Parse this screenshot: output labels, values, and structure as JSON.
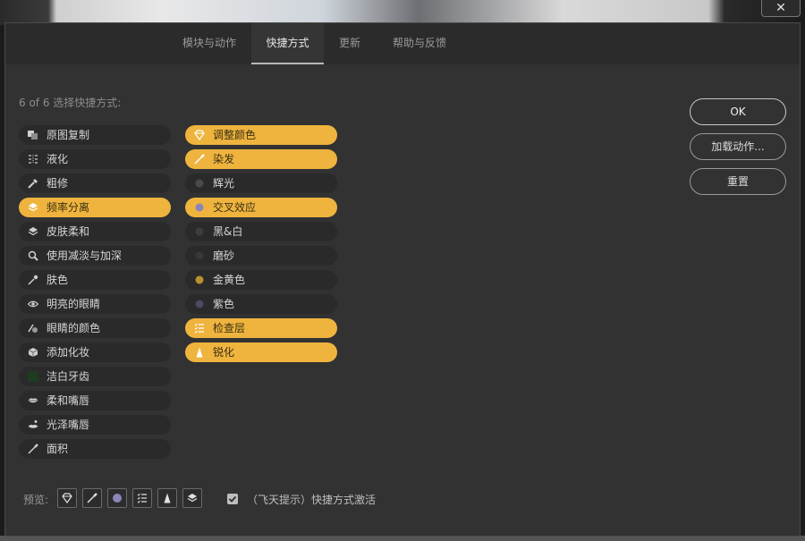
{
  "window": {
    "close_glyph": "✕"
  },
  "tabs": [
    {
      "label": "模块与动作",
      "active": false
    },
    {
      "label": "快捷方式",
      "active": true
    },
    {
      "label": "更新",
      "active": false
    },
    {
      "label": "帮助与反馈",
      "active": false
    }
  ],
  "selection_count": "6 of 6 选择快捷方式:",
  "left_list": [
    {
      "label": "原图复制",
      "icon": "copy-icon",
      "selected": false
    },
    {
      "label": "液化",
      "icon": "liquify-icon",
      "selected": false
    },
    {
      "label": "粗修",
      "icon": "healing-brush-icon",
      "selected": false
    },
    {
      "label": "频率分离",
      "icon": "layers-icon",
      "selected": true
    },
    {
      "label": "皮肤柔和",
      "icon": "layers-icon",
      "selected": false
    },
    {
      "label": "使用减淡与加深",
      "icon": "dodge-burn-icon",
      "selected": false
    },
    {
      "label": "肤色",
      "icon": "eyedropper-icon",
      "selected": false
    },
    {
      "label": "明亮的眼睛",
      "icon": "eye-icon",
      "selected": false
    },
    {
      "label": "眼睛的颜色",
      "icon": "eye-color-icon",
      "selected": false
    },
    {
      "label": "添加化妆",
      "icon": "cube-icon",
      "selected": false
    },
    {
      "label": "洁白牙齿",
      "icon": "tooth-icon",
      "selected": false
    },
    {
      "label": "柔和嘴唇",
      "icon": "lips-icon",
      "selected": false
    },
    {
      "label": "光泽嘴唇",
      "icon": "lips-gloss-icon",
      "selected": false
    },
    {
      "label": "面积",
      "icon": "brush-icon",
      "selected": false
    }
  ],
  "right_list": [
    {
      "label": "调整颜色",
      "icon": "diamond-icon",
      "selected": true
    },
    {
      "label": "染发",
      "icon": "brush-icon",
      "selected": true
    },
    {
      "label": "辉光",
      "icon": "dark-dot-icon",
      "selected": false
    },
    {
      "label": "交叉效应",
      "icon": "lavender-dot-icon",
      "selected": true
    },
    {
      "label": "黑&白",
      "icon": "dark-dot-icon",
      "selected": false
    },
    {
      "label": "磨砂",
      "icon": "dark-dot-icon",
      "selected": false
    },
    {
      "label": "金黄色",
      "icon": "gold-dot-icon",
      "selected": false
    },
    {
      "label": "紫色",
      "icon": "purple-dot-icon",
      "selected": false
    },
    {
      "label": "检查层",
      "icon": "checklist-icon",
      "selected": true
    },
    {
      "label": "锐化",
      "icon": "sharpen-icon",
      "selected": true
    }
  ],
  "buttons": {
    "ok": "OK",
    "load_actions": "加载动作...",
    "reset": "重置"
  },
  "preview": {
    "label": "预览:",
    "icons": [
      "diamond-icon",
      "brush-icon",
      "lavender-dot-icon",
      "checklist-icon",
      "sharpen-icon",
      "layers-icon"
    ]
  },
  "tips_checkbox": {
    "label": "（飞天提示）快捷方式激活",
    "checked": true
  },
  "colors": {
    "accent": "#efb43e",
    "panel": "#323232",
    "pill": "#2a2a2a"
  }
}
